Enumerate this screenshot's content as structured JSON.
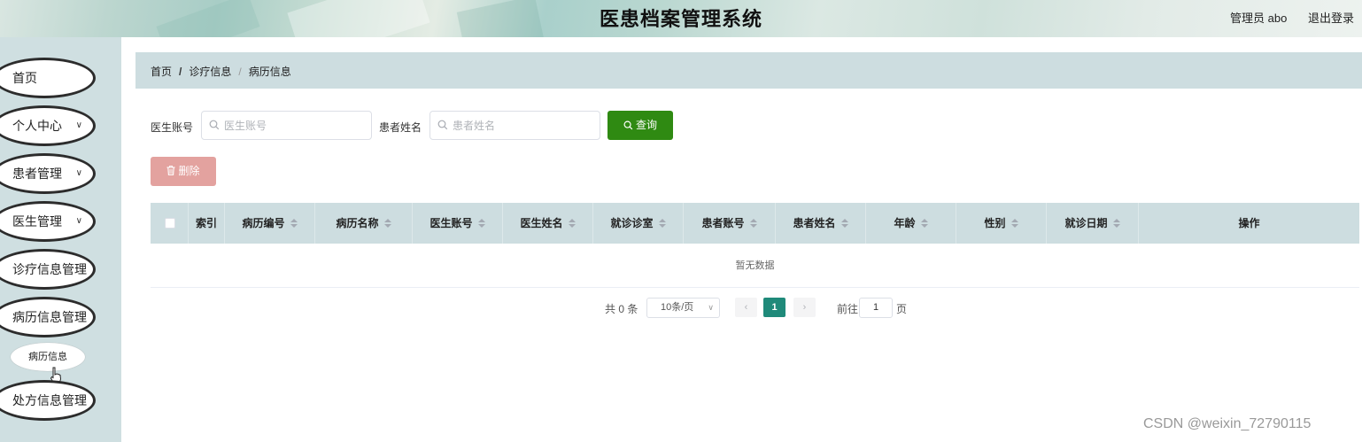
{
  "header": {
    "title": "医患档案管理系统",
    "user_label": "管理员 abo",
    "logout_label": "退出登录"
  },
  "sidebar": {
    "items": [
      {
        "label": "首页",
        "has_arrow": false
      },
      {
        "label": "个人中心",
        "has_arrow": true
      },
      {
        "label": "患者管理",
        "has_arrow": true
      },
      {
        "label": "医生管理",
        "has_arrow": true
      },
      {
        "label": "诊疗信息管理",
        "has_arrow": false
      },
      {
        "label": "病历信息管理",
        "has_arrow": false
      },
      {
        "label": "处方信息管理",
        "has_arrow": false
      }
    ],
    "sub_item": "病历信息",
    "arrow_glyph": "∨"
  },
  "breadcrumb": {
    "home": "首页",
    "sep1": "/",
    "level1": "诊疗信息",
    "sep2": "/",
    "level2": "病历信息"
  },
  "search": {
    "doctor_account_label": "医生账号",
    "doctor_account_placeholder": "医生账号",
    "patient_name_label": "患者姓名",
    "patient_name_placeholder": "患者姓名",
    "query_label": "查询"
  },
  "actions": {
    "delete_label": "删除"
  },
  "table": {
    "columns": [
      {
        "label": "索引",
        "sortable": false
      },
      {
        "label": "病历编号",
        "sortable": true
      },
      {
        "label": "病历名称",
        "sortable": true
      },
      {
        "label": "医生账号",
        "sortable": true
      },
      {
        "label": "医生姓名",
        "sortable": true
      },
      {
        "label": "就诊诊室",
        "sortable": true
      },
      {
        "label": "患者账号",
        "sortable": true
      },
      {
        "label": "患者姓名",
        "sortable": true
      },
      {
        "label": "年龄",
        "sortable": true
      },
      {
        "label": "性别",
        "sortable": true
      },
      {
        "label": "就诊日期",
        "sortable": true
      },
      {
        "label": "操作",
        "sortable": false
      }
    ],
    "empty_text": "暂无数据"
  },
  "pagination": {
    "total_text": "共 0 条",
    "page_size": "10条/页",
    "prev": "‹",
    "current_page": "1",
    "next": "›",
    "goto_label": "前往",
    "goto_value": "1",
    "page_suffix": "页"
  },
  "watermark": "CSDN @weixin_72790115",
  "colors": {
    "sidebar_bg": "#cfdfe1",
    "table_header_bg": "#cddde0",
    "query_button": "#2f8a12",
    "delete_button": "#e3a29f",
    "active_page": "#1f8a7a"
  }
}
